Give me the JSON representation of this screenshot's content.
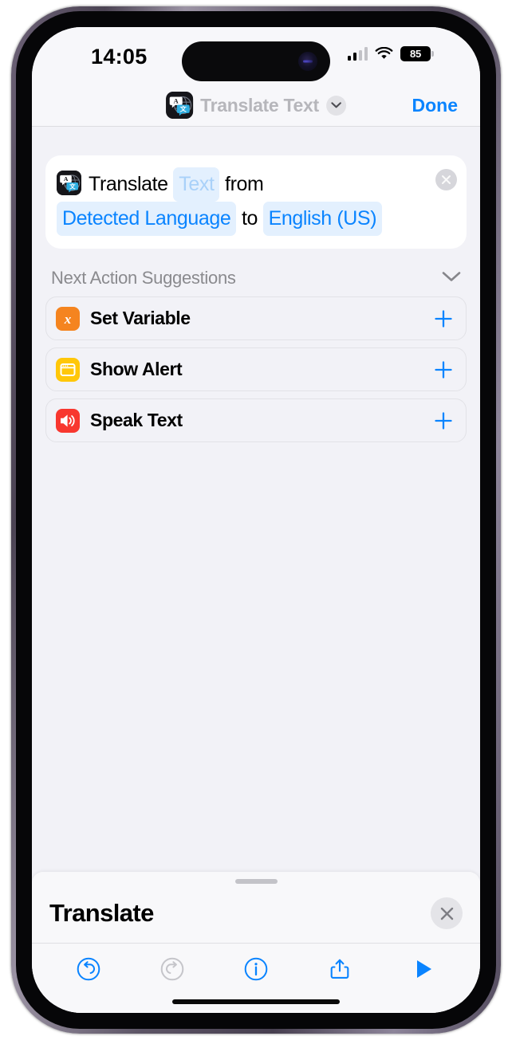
{
  "status_bar": {
    "time": "14:05",
    "signal_icon": "cellular-signal-icon",
    "signal_bars_filled": 2,
    "signal_bars_total": 4,
    "wifi_icon": "wifi-icon",
    "battery_level": "85",
    "battery_icon": "battery-icon"
  },
  "nav_bar": {
    "app_icon": "translate-app-icon",
    "title": "Translate Text",
    "chevron_icon": "chevron-down-icon",
    "done_label": "Done"
  },
  "action_card": {
    "icon": "translate-app-icon",
    "close_icon": "close-circle-icon",
    "phrase": {
      "verb": "Translate",
      "input_token": "Text",
      "connector_from": "from",
      "source_language": "Detected Language",
      "connector_to": "to",
      "target_language": "English (US)"
    }
  },
  "suggestions": {
    "header": "Next Action Suggestions",
    "collapse_icon": "chevron-down-icon",
    "items": [
      {
        "label": "Set Variable",
        "icon": "variable-icon",
        "icon_glyph": "x",
        "color": "#f5841f",
        "add_icon": "plus-icon"
      },
      {
        "label": "Show Alert",
        "icon": "alert-window-icon",
        "icon_glyph": "window",
        "color": "#ffc709",
        "add_icon": "plus-icon"
      },
      {
        "label": "Speak Text",
        "icon": "speaker-icon",
        "icon_glyph": "speaker",
        "color": "#f8372f",
        "add_icon": "plus-icon"
      }
    ]
  },
  "bottom_sheet": {
    "grabber": "sheet-grabber",
    "title": "Translate",
    "close_icon": "close-icon",
    "toolbar": [
      {
        "name": "undo-button",
        "icon": "undo-icon",
        "enabled": true
      },
      {
        "name": "redo-button",
        "icon": "redo-icon",
        "enabled": false
      },
      {
        "name": "info-button",
        "icon": "info-icon",
        "enabled": true
      },
      {
        "name": "share-button",
        "icon": "share-icon",
        "enabled": true
      },
      {
        "name": "run-button",
        "icon": "play-icon",
        "enabled": true
      }
    ]
  },
  "colors": {
    "accent_blue": "#0a84ff",
    "token_bg": "#e3f0fe",
    "placeholder_blue": "#a9d1f9",
    "screen_bg": "#f2f2f7",
    "card_bg": "#ffffff",
    "secondary_text": "#8a8a8e"
  }
}
